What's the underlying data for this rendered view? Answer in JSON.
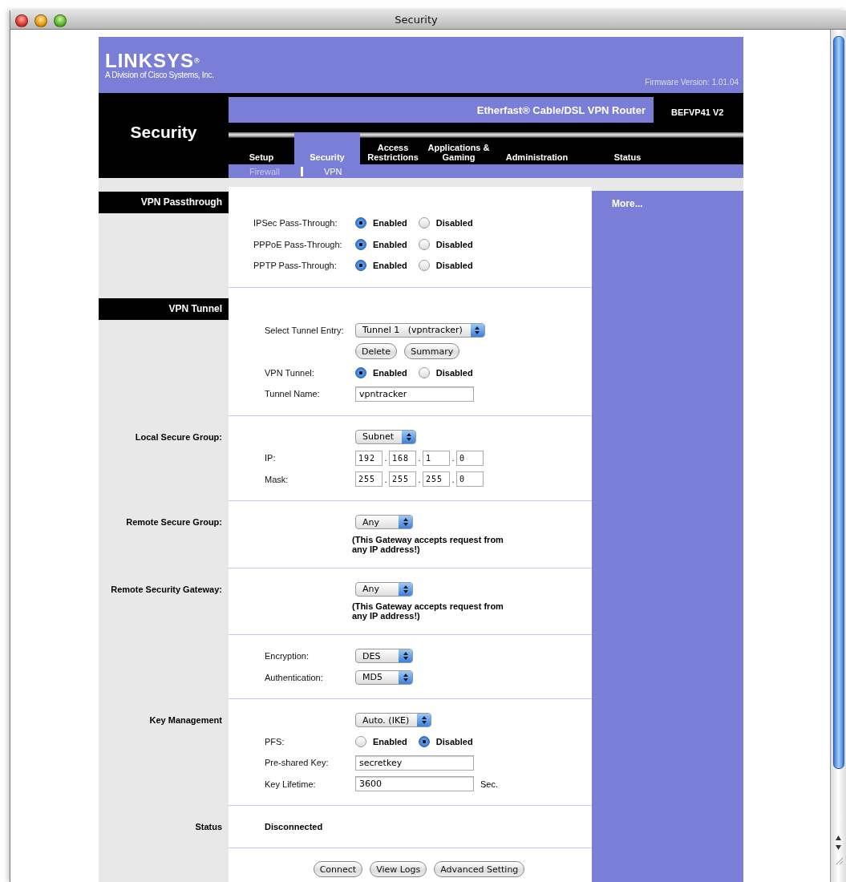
{
  "window": {
    "title": "Security"
  },
  "header": {
    "logo": "LINKSYS",
    "logo_mark": "®",
    "tagline": "A Division of Cisco Systems, Inc.",
    "firmware": "Firmware Version: 1.01.04"
  },
  "page_title": "Security",
  "product": {
    "name": "Etherfast® Cable/DSL VPN Router",
    "model": "BEFVP41 V2"
  },
  "tabs": [
    {
      "label": "Setup",
      "selected": false
    },
    {
      "label": "Security",
      "selected": true
    },
    {
      "label": "Access Restrictions",
      "selected": false
    },
    {
      "label": "Applications & Gaming",
      "selected": false
    },
    {
      "label": "Administration",
      "selected": false
    },
    {
      "label": "Status",
      "selected": false
    }
  ],
  "subtabs": [
    {
      "label": "Firewall",
      "selected": false
    },
    {
      "label": "VPN",
      "selected": true
    }
  ],
  "more_link": "More...",
  "sections": [
    {
      "kind": "header",
      "label": "VPN Passthrough",
      "rows": [
        {
          "kind": "radio",
          "label": "IPSec Pass-Through:",
          "options": [
            {
              "label": "Enabled",
              "selected": true
            },
            {
              "label": "Disabled",
              "selected": false
            }
          ]
        },
        {
          "kind": "radio",
          "label": "PPPoE Pass-Through:",
          "options": [
            {
              "label": "Enabled",
              "selected": true
            },
            {
              "label": "Disabled",
              "selected": false
            }
          ]
        },
        {
          "kind": "radio",
          "label": "PPTP Pass-Through:",
          "options": [
            {
              "label": "Enabled",
              "selected": true
            },
            {
              "label": "Disabled",
              "selected": false
            }
          ]
        }
      ]
    },
    {
      "kind": "header",
      "label": "VPN Tunnel",
      "rows": [
        {
          "kind": "select",
          "label": "Select Tunnel Entry:",
          "value": "Tunnel 1   (vpntracker)"
        },
        {
          "kind": "buttons",
          "buttons": [
            "Delete",
            "Summary"
          ]
        },
        {
          "kind": "radio",
          "label": "VPN Tunnel:",
          "options": [
            {
              "label": "Enabled",
              "selected": true
            },
            {
              "label": "Disabled",
              "selected": false
            }
          ]
        },
        {
          "kind": "text",
          "label": "Tunnel Name:",
          "value": "vpntracker"
        }
      ]
    },
    {
      "kind": "label",
      "label": "Local Secure Group:",
      "rows": [
        {
          "kind": "select",
          "value": "Subnet"
        },
        {
          "kind": "ip",
          "label": "IP:",
          "separator": ".",
          "octets": [
            "192",
            "168",
            "1",
            "0"
          ]
        },
        {
          "kind": "ip",
          "label": "Mask:",
          "separator": ".",
          "octets": [
            "255",
            "255",
            "255",
            "0"
          ]
        }
      ]
    },
    {
      "kind": "label",
      "label": "Remote Secure Group:",
      "rows": [
        {
          "kind": "select",
          "value": "Any"
        },
        {
          "kind": "note",
          "text": "(This Gateway accepts request from any IP address!)"
        }
      ]
    },
    {
      "kind": "label",
      "label": "Remote Security Gateway:",
      "rows": [
        {
          "kind": "select",
          "value": "Any"
        },
        {
          "kind": "note",
          "text": "(This Gateway accepts request from any IP address!)"
        }
      ]
    },
    {
      "kind": "plain",
      "rows": [
        {
          "kind": "select",
          "label": "Encryption:",
          "value": "DES"
        },
        {
          "kind": "select",
          "label": "Authentication:",
          "value": "MD5"
        }
      ]
    },
    {
      "kind": "label",
      "label": "Key Management",
      "rows": [
        {
          "kind": "select",
          "value": "Auto. (IKE)"
        },
        {
          "kind": "radio",
          "label": "PFS:",
          "options": [
            {
              "label": "Enabled",
              "selected": false
            },
            {
              "label": "Disabled",
              "selected": true
            }
          ]
        },
        {
          "kind": "text",
          "label": "Pre-shared Key:",
          "value": "secretkey"
        },
        {
          "kind": "text",
          "label": "Key Lifetime:",
          "value": "3600",
          "unit": "Sec."
        }
      ]
    },
    {
      "kind": "label",
      "label": "Status",
      "rows": [
        {
          "kind": "status",
          "text": "Disconnected"
        }
      ]
    },
    {
      "kind": "plain",
      "rows": [
        {
          "kind": "actions",
          "buttons": [
            "Connect",
            "View Logs",
            "Advanced Setting"
          ]
        }
      ]
    }
  ]
}
